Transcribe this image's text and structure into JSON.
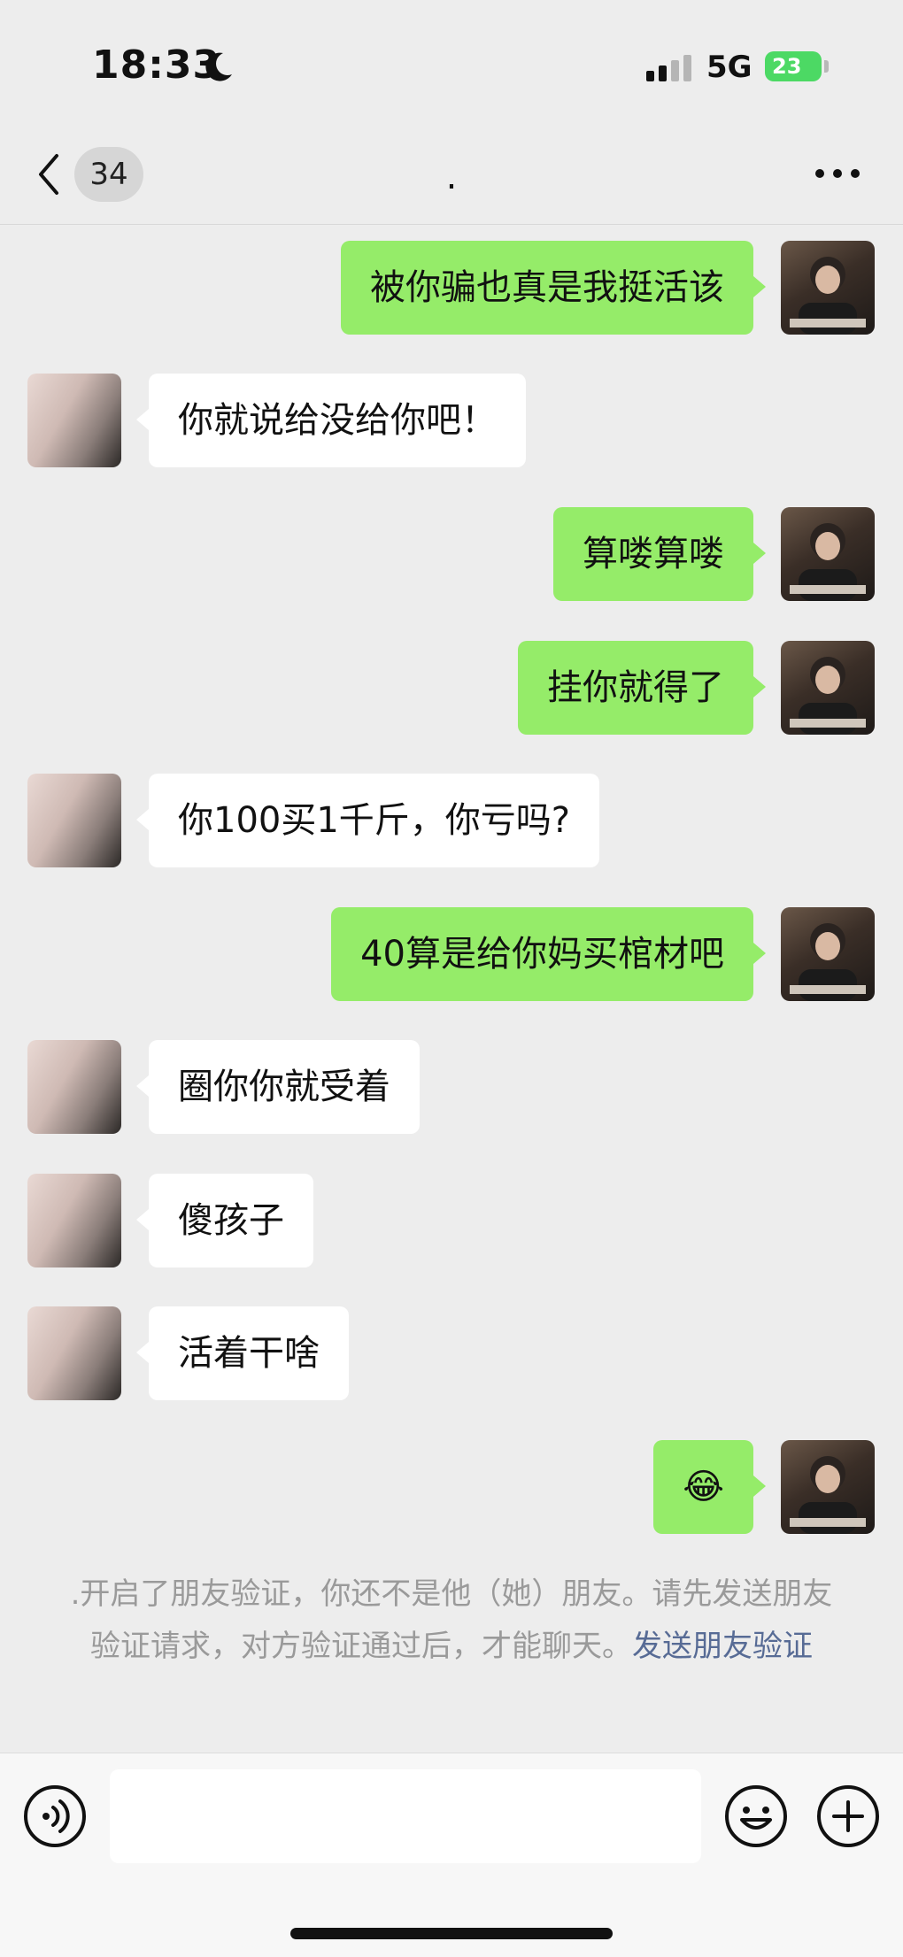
{
  "status_bar": {
    "time": "18:33",
    "network": "5G",
    "battery": "23"
  },
  "nav": {
    "unread_count": "34",
    "title": "."
  },
  "messages": [
    {
      "side": "right",
      "text": "被你骗也真是我挺活该"
    },
    {
      "side": "left",
      "text": "你就说给没给你吧！"
    },
    {
      "side": "right",
      "text": "算喽算喽"
    },
    {
      "side": "right",
      "text": "挂你就得了"
    },
    {
      "side": "left",
      "text": "你100买1千斤，你亏吗?"
    },
    {
      "side": "right",
      "text": "40算是给你妈买棺材吧"
    },
    {
      "side": "left",
      "text": "圈你你就受着"
    },
    {
      "side": "left",
      "text": "傻孩子"
    },
    {
      "side": "left",
      "text": "活着干啥"
    },
    {
      "side": "right",
      "text": "😂"
    }
  ],
  "system_note": {
    "text": ".开启了朋友验证，你还不是他（她）朋友。请先发送朋友验证请求，对方验证通过后，才能聊天。",
    "link": "发送朋友验证"
  },
  "icons": {
    "back": "chevron-left-icon",
    "more": "more-dots-icon",
    "voice": "voice-icon",
    "emoji": "emoji-icon",
    "plus": "plus-icon",
    "moon": "moon-icon",
    "signal": "signal-icon"
  },
  "colors": {
    "background": "#ededed",
    "sent_bubble": "#95ec69",
    "received_bubble": "#ffffff",
    "link": "#576b95",
    "battery": "#4cd964"
  }
}
